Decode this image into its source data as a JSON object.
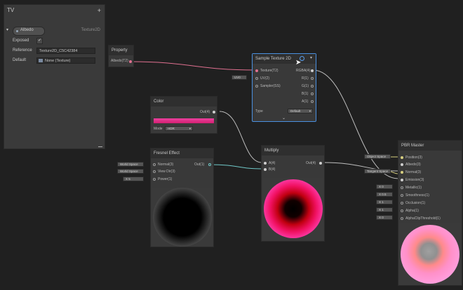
{
  "blackboard": {
    "title": "TV",
    "add_icon": "plus-icon",
    "property_name": "Albedo",
    "property_type": "Texture2D",
    "exposed_label": "Exposed",
    "reference_label": "Reference",
    "reference_value": "Texture2D_C5C42384",
    "default_label": "Default",
    "default_value": "None (Texture)"
  },
  "nodes": {
    "property": {
      "title": "Property",
      "port": "Albedo(T2)"
    },
    "sample_texture": {
      "title": "Sample Texture 2D",
      "inputs": [
        "Texture(T2)",
        "UV(2)",
        "Sampler(SS)"
      ],
      "uv_chip": "UV0",
      "outputs": [
        "RGBA(4)",
        "R(1)",
        "G(1)",
        "B(1)",
        "A(1)"
      ],
      "type_label": "Type",
      "type_value": "Default"
    },
    "color": {
      "title": "Color",
      "port": "Out(4)",
      "mode_label": "Mode",
      "mode_value": "HDR",
      "swatch": "#e02e88"
    },
    "fresnel": {
      "title": "Fresnel Effect",
      "inputs": [
        "Normal(3)",
        "View Dir(3)",
        "Power(1)"
      ],
      "output": "Out(1)",
      "chips": [
        "World Space",
        "World Space",
        "X  5"
      ]
    },
    "multiply": {
      "title": "Multiply",
      "inputs": [
        "A(4)",
        "B(4)"
      ],
      "output": "Out(4)"
    },
    "pbr": {
      "title": "PBR Master",
      "inputs": [
        "Position(3)",
        "Albedo(3)",
        "Normal(3)",
        "Emission(3)",
        "Metallic(1)",
        "Smoothness(1)",
        "Occlusion(1)",
        "Alpha(1)",
        "AlphaClipThreshold(1)"
      ],
      "chips": [
        "Object Space",
        "Tangent Space",
        "X  0",
        "X  0.5",
        "X  1",
        "X  1",
        "X  0"
      ]
    }
  },
  "colors": {
    "background": "#202020",
    "node": "#393939",
    "header": "#2f2f2f",
    "selection": "#4a90e0",
    "wire_pink": "#e07090",
    "wire_gray": "#bfbfbf",
    "wire_teal": "#70c8c8",
    "wire_yellow": "#d8d080"
  }
}
